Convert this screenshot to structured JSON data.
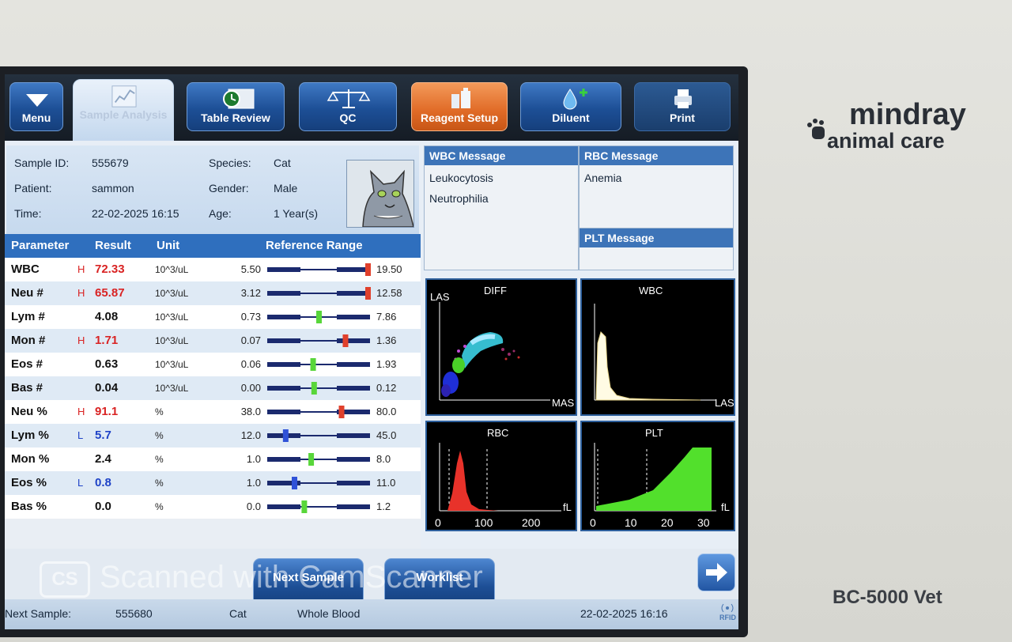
{
  "toolbar": {
    "menu": "Menu",
    "sample_analysis": "Sample Analysis",
    "table_review": "Table Review",
    "qc": "QC",
    "reagent_setup": "Reagent Setup",
    "diluent": "Diluent",
    "print": "Print"
  },
  "sample": {
    "id_label": "Sample ID:",
    "id": "555679",
    "patient_label": "Patient:",
    "patient": "sammon",
    "time_label": "Time:",
    "time": "22-02-2025 16:15",
    "species_label": "Species:",
    "species": "Cat",
    "gender_label": "Gender:",
    "gender": "Male",
    "age_label": "Age:",
    "age": "1 Year(s)"
  },
  "table": {
    "headers": {
      "parameter": "Parameter",
      "result": "Result",
      "unit": "Unit",
      "range": "Reference Range"
    },
    "rows": [
      {
        "param": "WBC",
        "flag": "H",
        "result": "72.33",
        "unit": "10^3/uL",
        "low": "5.50",
        "high": "19.50",
        "marker": 1.0,
        "color": "#e0402c"
      },
      {
        "param": "Neu #",
        "flag": "H",
        "result": "65.87",
        "unit": "10^3/uL",
        "low": "3.12",
        "high": "12.58",
        "marker": 1.0,
        "color": "#e0402c"
      },
      {
        "param": "Lym #",
        "flag": "",
        "result": "4.08",
        "unit": "10^3/uL",
        "low": "0.73",
        "high": "7.86",
        "marker": 0.5,
        "color": "#58d63a"
      },
      {
        "param": "Mon #",
        "flag": "H",
        "result": "1.71",
        "unit": "10^3/uL",
        "low": "0.07",
        "high": "1.36",
        "marker": 0.77,
        "color": "#e0402c"
      },
      {
        "param": "Eos #",
        "flag": "",
        "result": "0.63",
        "unit": "10^3/uL",
        "low": "0.06",
        "high": "1.93",
        "marker": 0.44,
        "color": "#58d63a"
      },
      {
        "param": "Bas #",
        "flag": "",
        "result": "0.04",
        "unit": "10^3/uL",
        "low": "0.00",
        "high": "0.12",
        "marker": 0.45,
        "color": "#58d63a"
      },
      {
        "param": "Neu %",
        "flag": "H",
        "result": "91.1",
        "unit": "%",
        "low": "38.0",
        "high": "80.0",
        "marker": 0.73,
        "color": "#e0402c"
      },
      {
        "param": "Lym %",
        "flag": "L",
        "result": "5.7",
        "unit": "%",
        "low": "12.0",
        "high": "45.0",
        "marker": 0.16,
        "color": "#2f52d8"
      },
      {
        "param": "Mon %",
        "flag": "",
        "result": "2.4",
        "unit": "%",
        "low": "1.0",
        "high": "8.0",
        "marker": 0.42,
        "color": "#58d63a"
      },
      {
        "param": "Eos %",
        "flag": "L",
        "result": "0.8",
        "unit": "%",
        "low": "1.0",
        "high": "11.0",
        "marker": 0.25,
        "color": "#2f52d8"
      },
      {
        "param": "Bas %",
        "flag": "",
        "result": "0.0",
        "unit": "%",
        "low": "0.0",
        "high": "1.2",
        "marker": 0.35,
        "color": "#58d63a"
      }
    ]
  },
  "messages": {
    "wbc_title": "WBC Message",
    "wbc_1": "Leukocytosis",
    "wbc_2": "Neutrophilia",
    "rbc_title": "RBC Message",
    "rbc_1": "Anemia",
    "plt_title": "PLT Message"
  },
  "graphs": {
    "diff": {
      "title": "DIFF",
      "y": "LAS",
      "x": "MAS"
    },
    "wbc": {
      "title": "WBC",
      "x": "LAS"
    },
    "rbc": {
      "title": "RBC",
      "x": "fL",
      "ticks": [
        "0",
        "100",
        "200"
      ]
    },
    "plt": {
      "title": "PLT",
      "x": "fL",
      "ticks": [
        "0",
        "10",
        "20",
        "30"
      ]
    }
  },
  "footer": {
    "next_sample_btn": "Next Sample",
    "worklist_btn": "Worklist",
    "next_label": "Next Sample:",
    "next_id": "555680",
    "next_species": "Cat",
    "next_mode": "Whole Blood",
    "datetime": "22-02-2025 16:16",
    "rfid": "RFID"
  },
  "watermark": "Scanned with CamScanner",
  "watermark_logo": "CS",
  "brand": {
    "line1": "mindray",
    "line2": "animal care",
    "model": "BC-5000 Vet"
  }
}
